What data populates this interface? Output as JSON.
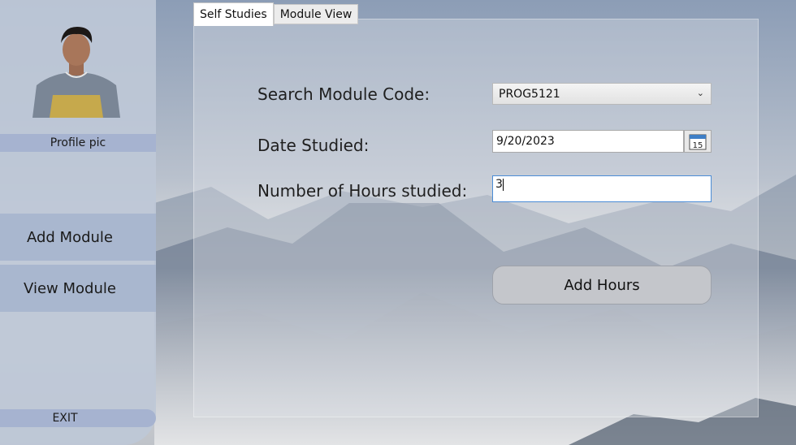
{
  "sidebar": {
    "profile_label": "Profile pic",
    "add_module": "Add Module",
    "view_module": "View Module",
    "exit": "EXIT"
  },
  "tabs": [
    {
      "label": "Self Studies",
      "active": true
    },
    {
      "label": "Module View",
      "active": false
    }
  ],
  "form": {
    "module_code_label": "Search Module Code:",
    "module_code_value": "PROG5121",
    "date_label": "Date Studied:",
    "date_value": "9/20/2023",
    "calendar_day": "15",
    "hours_label": "Number of Hours studied:",
    "hours_value": "3",
    "add_hours_button": "Add Hours"
  },
  "colors": {
    "sidebar_bg": "#bec8d7",
    "sidebar_button": "#a9b7cf",
    "focus_border": "#4a8cd6"
  }
}
